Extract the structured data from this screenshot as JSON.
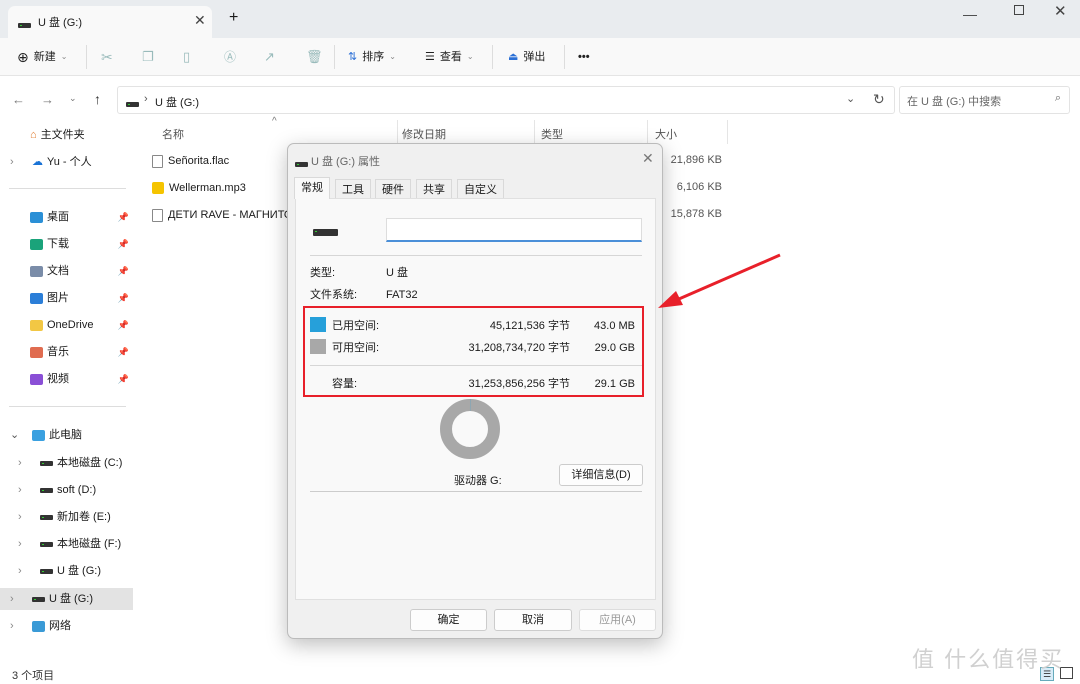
{
  "window": {
    "tab_title": "U 盘 (G:)",
    "new_tab": "+",
    "controls": [
      "minimize",
      "maximize",
      "close"
    ]
  },
  "toolbar": {
    "new": "新建",
    "sort": "排序",
    "view": "查看",
    "eject": "弹出",
    "more": "•••"
  },
  "address": {
    "path": "U 盘 (G:)",
    "search_placeholder": "在 U 盘 (G:) 中搜索"
  },
  "sidebar": {
    "home": "主文件夹",
    "onedrive_personal": "Yu - 个人",
    "pinned": [
      {
        "label": "桌面",
        "color": "#2a8fd6"
      },
      {
        "label": "下载",
        "color": "#1aa37a"
      },
      {
        "label": "文档",
        "color": "#7a8ca8"
      },
      {
        "label": "图片",
        "color": "#2b7ed8"
      },
      {
        "label": "OneDrive",
        "color": "#f2c744"
      },
      {
        "label": "音乐",
        "color": "#e06c50"
      },
      {
        "label": "视频",
        "color": "#8a4fd6"
      }
    ],
    "this_pc": "此电脑",
    "drives": [
      "本地磁盘 (C:)",
      "soft (D:)",
      "新加卷 (E:)",
      "本地磁盘 (F:)",
      "U 盘 (G:)"
    ],
    "selected": "U 盘 (G:)",
    "network": "网络"
  },
  "columns": {
    "name": "名称",
    "date": "修改日期",
    "type": "类型",
    "size": "大小"
  },
  "files": [
    {
      "name": "Señorita.flac",
      "size": "21,896 KB"
    },
    {
      "name": "Wellerman.mp3",
      "size": "6,106 KB"
    },
    {
      "name": "ДЕТИ RAVE - МАГНИТО",
      "size": "15,878 KB"
    }
  ],
  "status": {
    "count": "3 个项目"
  },
  "dialog": {
    "title": "U 盘 (G:) 属性",
    "tabs": [
      "常规",
      "工具",
      "硬件",
      "共享",
      "自定义"
    ],
    "active_tab": "常规",
    "name_value": "",
    "type_label": "类型:",
    "type_value": "U 盘",
    "fs_label": "文件系统:",
    "fs_value": "FAT32",
    "used": {
      "label": "已用空间:",
      "bytes": "45,121,536 字节",
      "size": "43.0 MB",
      "color": "#26a0da"
    },
    "free": {
      "label": "可用空间:",
      "bytes": "31,208,734,720 字节",
      "size": "29.0 GB",
      "color": "#a8a8a8"
    },
    "capacity": {
      "label": "容量:",
      "bytes": "31,253,856,256 字节",
      "size": "29.1 GB"
    },
    "used_fraction": 0.0014,
    "drive_label": "驱动器 G:",
    "details_button": "详细信息(D)",
    "ok": "确定",
    "cancel": "取消",
    "apply": "应用(A)"
  },
  "annotation": {
    "color": "#e8202a"
  },
  "watermark": "值 什么值得买"
}
